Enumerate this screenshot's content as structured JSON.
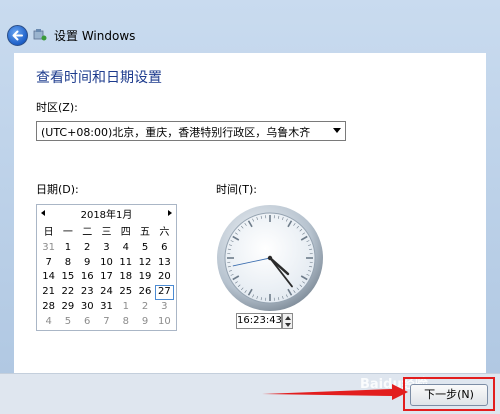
{
  "window": {
    "title": "设置 Windows"
  },
  "page": {
    "heading": "查看时间和日期设置",
    "timezone": {
      "label": "时区(Z):",
      "value": "(UTC+08:00)北京，重庆，香港特别行政区，乌鲁木齐"
    },
    "date": {
      "label": "日期(D):",
      "month_title": "2018年1月",
      "weekdays": [
        "日",
        "一",
        "二",
        "三",
        "四",
        "五",
        "六"
      ],
      "weeks": [
        [
          "31",
          "1",
          "2",
          "3",
          "4",
          "5",
          "6"
        ],
        [
          "7",
          "8",
          "9",
          "10",
          "11",
          "12",
          "13"
        ],
        [
          "14",
          "15",
          "16",
          "17",
          "18",
          "19",
          "20"
        ],
        [
          "21",
          "22",
          "23",
          "24",
          "25",
          "26",
          "27"
        ],
        [
          "28",
          "29",
          "30",
          "31",
          "1",
          "2",
          "3"
        ],
        [
          "4",
          "5",
          "6",
          "7",
          "8",
          "9",
          "10"
        ]
      ],
      "selected_day": "27"
    },
    "time": {
      "label": "时间(T):",
      "value": "16:23:43"
    }
  },
  "footer": {
    "next_label": "下一步(N)"
  },
  "watermark": "Baidu经验",
  "colors": {
    "heading": "#1e3c8e",
    "highlight": "#e21e1e"
  }
}
